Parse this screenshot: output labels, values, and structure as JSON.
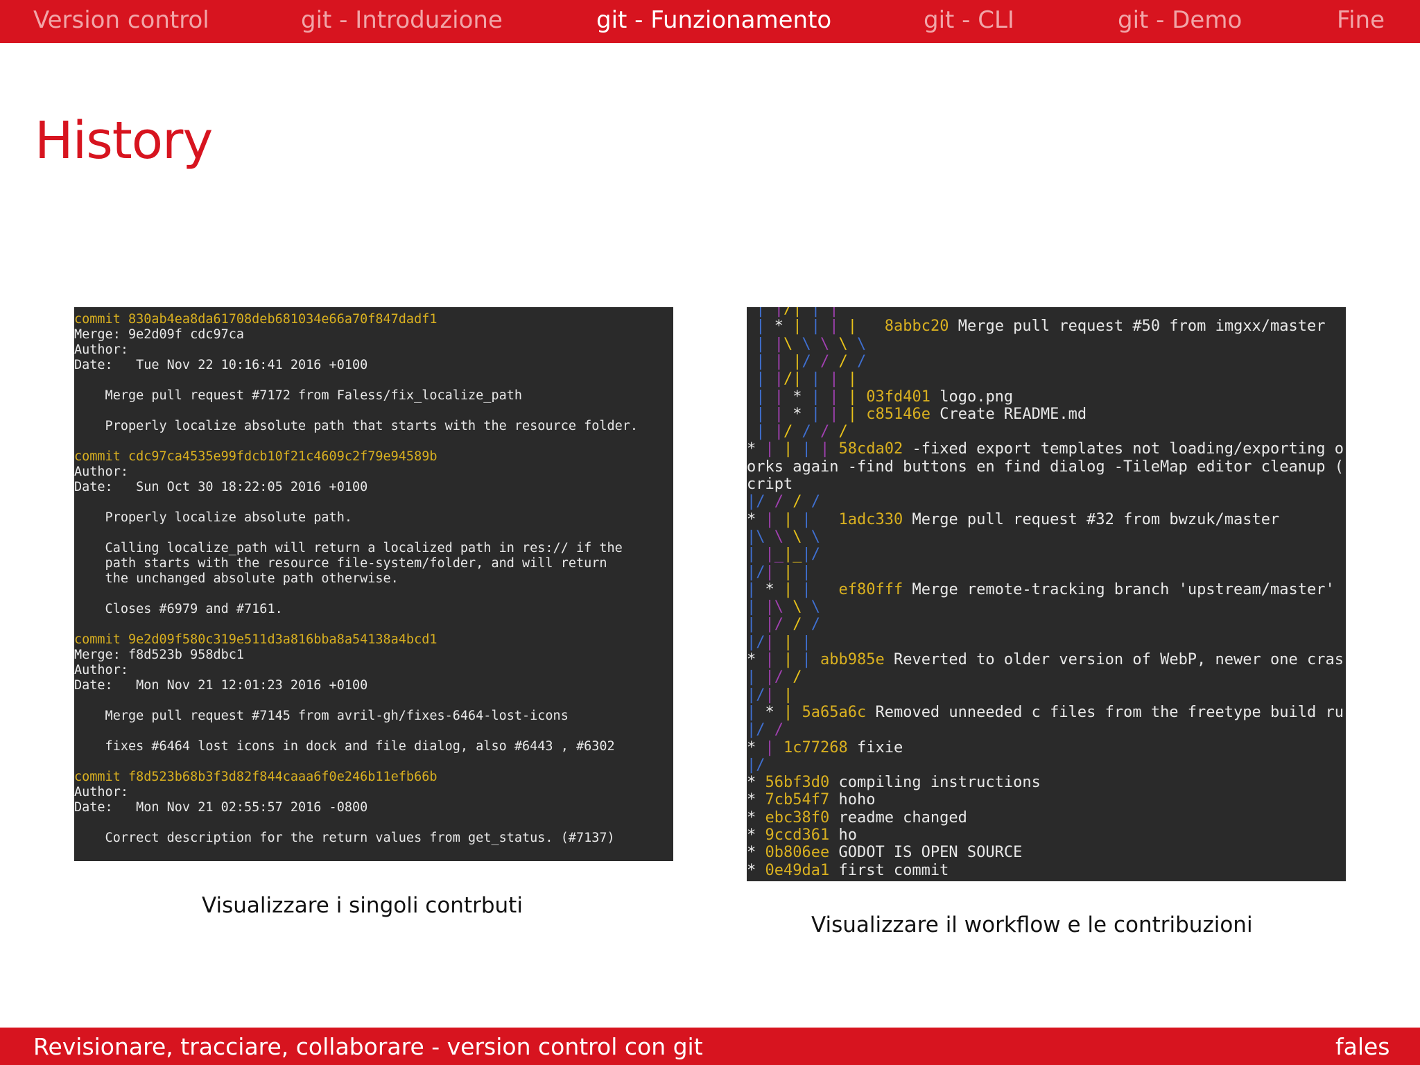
{
  "nav": {
    "items": [
      "Version control",
      "git - Introduzione",
      "git - Funzionamento",
      "git - CLI",
      "git - Demo",
      "Fine"
    ],
    "active": "git - Funzionamento"
  },
  "title": "History",
  "log_panel": {
    "lines": [
      "commit 830ab4ea8da61708deb681034e66a70f847dadf1",
      "Merge: 9e2d09f cdc97ca",
      "Author:",
      "Date:   Tue Nov 22 10:16:41 2016 +0100",
      "    Merge pull request #7172 from Faless/fix_localize_path",
      "    Properly localize absolute path that starts with the resource folder.",
      "commit cdc97ca4535e99fdcb10f21c4609c2f79e94589b",
      "Author:",
      "Date:   Sun Oct 30 18:22:05 2016 +0100",
      "    Properly localize absolute path.",
      "    Calling localize_path will return a localized path in res:// if the",
      "    path starts with the resource file-system/folder, and will return",
      "    the unchanged absolute path otherwise.",
      "    Closes #6979 and #7161.",
      "commit 9e2d09f580c319e511d3a816bba8a54138a4bcd1",
      "Merge: f8d523b 958dbc1",
      "Author:",
      "Date:   Mon Nov 21 12:01:23 2016 +0100",
      "    Merge pull request #7145 from avril-gh/fixes-6464-lost-icons",
      "    fixes #6464 lost icons in dock and file dialog, also #6443 , #6302",
      "commit f8d523b68b3f3d82f844caaa6f0e246b11efb66b",
      "Author:",
      "Date:   Mon Nov 21 02:55:57 2016 -0800",
      "    Correct description for the return values from get_status. (#7137)"
    ]
  },
  "graph_panel": {
    "lines": [
      {
        "graph": " | |/| | |",
        "hash": "",
        "msg": ""
      },
      {
        "graph": " | * | | | |   ",
        "hash": "8abbc20",
        "msg": " Merge pull request #50 from imgxx/master"
      },
      {
        "graph": " | |\\ \\ \\ \\ \\",
        "hash": "",
        "msg": ""
      },
      {
        "graph": " | | |/ / / /",
        "hash": "",
        "msg": ""
      },
      {
        "graph": " | |/| | | |",
        "hash": "",
        "msg": ""
      },
      {
        "graph": " | | * | | | ",
        "hash": "03fd401",
        "msg": " logo.png"
      },
      {
        "graph": " | | * | | | ",
        "hash": "c85146e",
        "msg": " Create README.md"
      },
      {
        "graph": " | |/ / / /",
        "hash": "",
        "msg": ""
      },
      {
        "graph": "* | | | | ",
        "hash": "58cda02",
        "msg": " -fixed export templates not loading/exporting o"
      },
      {
        "graph": "",
        "hash": "",
        "msg": "orks again -find buttons en find dialog -TileMap editor cleanup ("
      },
      {
        "graph": "",
        "hash": "",
        "msg": "cript"
      },
      {
        "graph": "|/ / / /",
        "hash": "",
        "msg": ""
      },
      {
        "graph": "* | | |   ",
        "hash": "1adc330",
        "msg": " Merge pull request #32 from bwzuk/master"
      },
      {
        "graph": "|\\ \\ \\ \\",
        "hash": "",
        "msg": ""
      },
      {
        "graph": "| |_|_|/",
        "hash": "",
        "msg": ""
      },
      {
        "graph": "|/| | |",
        "hash": "",
        "msg": ""
      },
      {
        "graph": "| * | |   ",
        "hash": "ef80fff",
        "msg": " Merge remote-tracking branch 'upstream/master'"
      },
      {
        "graph": "| |\\ \\ \\",
        "hash": "",
        "msg": ""
      },
      {
        "graph": "| |/ / /",
        "hash": "",
        "msg": ""
      },
      {
        "graph": "|/| | |",
        "hash": "",
        "msg": ""
      },
      {
        "graph": "* | | | ",
        "hash": "abb985e",
        "msg": " Reverted to older version of WebP, newer one cras"
      },
      {
        "graph": "| |/ /",
        "hash": "",
        "msg": ""
      },
      {
        "graph": "|/| |",
        "hash": "",
        "msg": ""
      },
      {
        "graph": "| * | ",
        "hash": "5a65a6c",
        "msg": " Removed unneeded c files from the freetype build ru"
      },
      {
        "graph": "|/ /",
        "hash": "",
        "msg": ""
      },
      {
        "graph": "* | ",
        "hash": "1c77268",
        "msg": " fixie"
      },
      {
        "graph": "|/",
        "hash": "",
        "msg": ""
      },
      {
        "graph": "* ",
        "hash": "56bf3d0",
        "msg": " compiling instructions"
      },
      {
        "graph": "* ",
        "hash": "7cb54f7",
        "msg": " hoho"
      },
      {
        "graph": "* ",
        "hash": "ebc38f0",
        "msg": " readme changed"
      },
      {
        "graph": "* ",
        "hash": "9ccd361",
        "msg": " ho"
      },
      {
        "graph": "* ",
        "hash": "0b806ee",
        "msg": " GODOT IS OPEN SOURCE"
      },
      {
        "graph": "* ",
        "hash": "0e49da1",
        "msg": " first commit"
      }
    ]
  },
  "captions": {
    "left": "Visualizzare i singoli contrbuti",
    "right": "Visualizzare il workflow e le contribuzioni"
  },
  "footer": {
    "left": "Revisionare, tracciare, collaborare - version control con git",
    "right": "fales"
  },
  "colors": {
    "accent": "#d7141f",
    "terminal_bg": "#2a2a2a",
    "hash": "#d9b020"
  }
}
